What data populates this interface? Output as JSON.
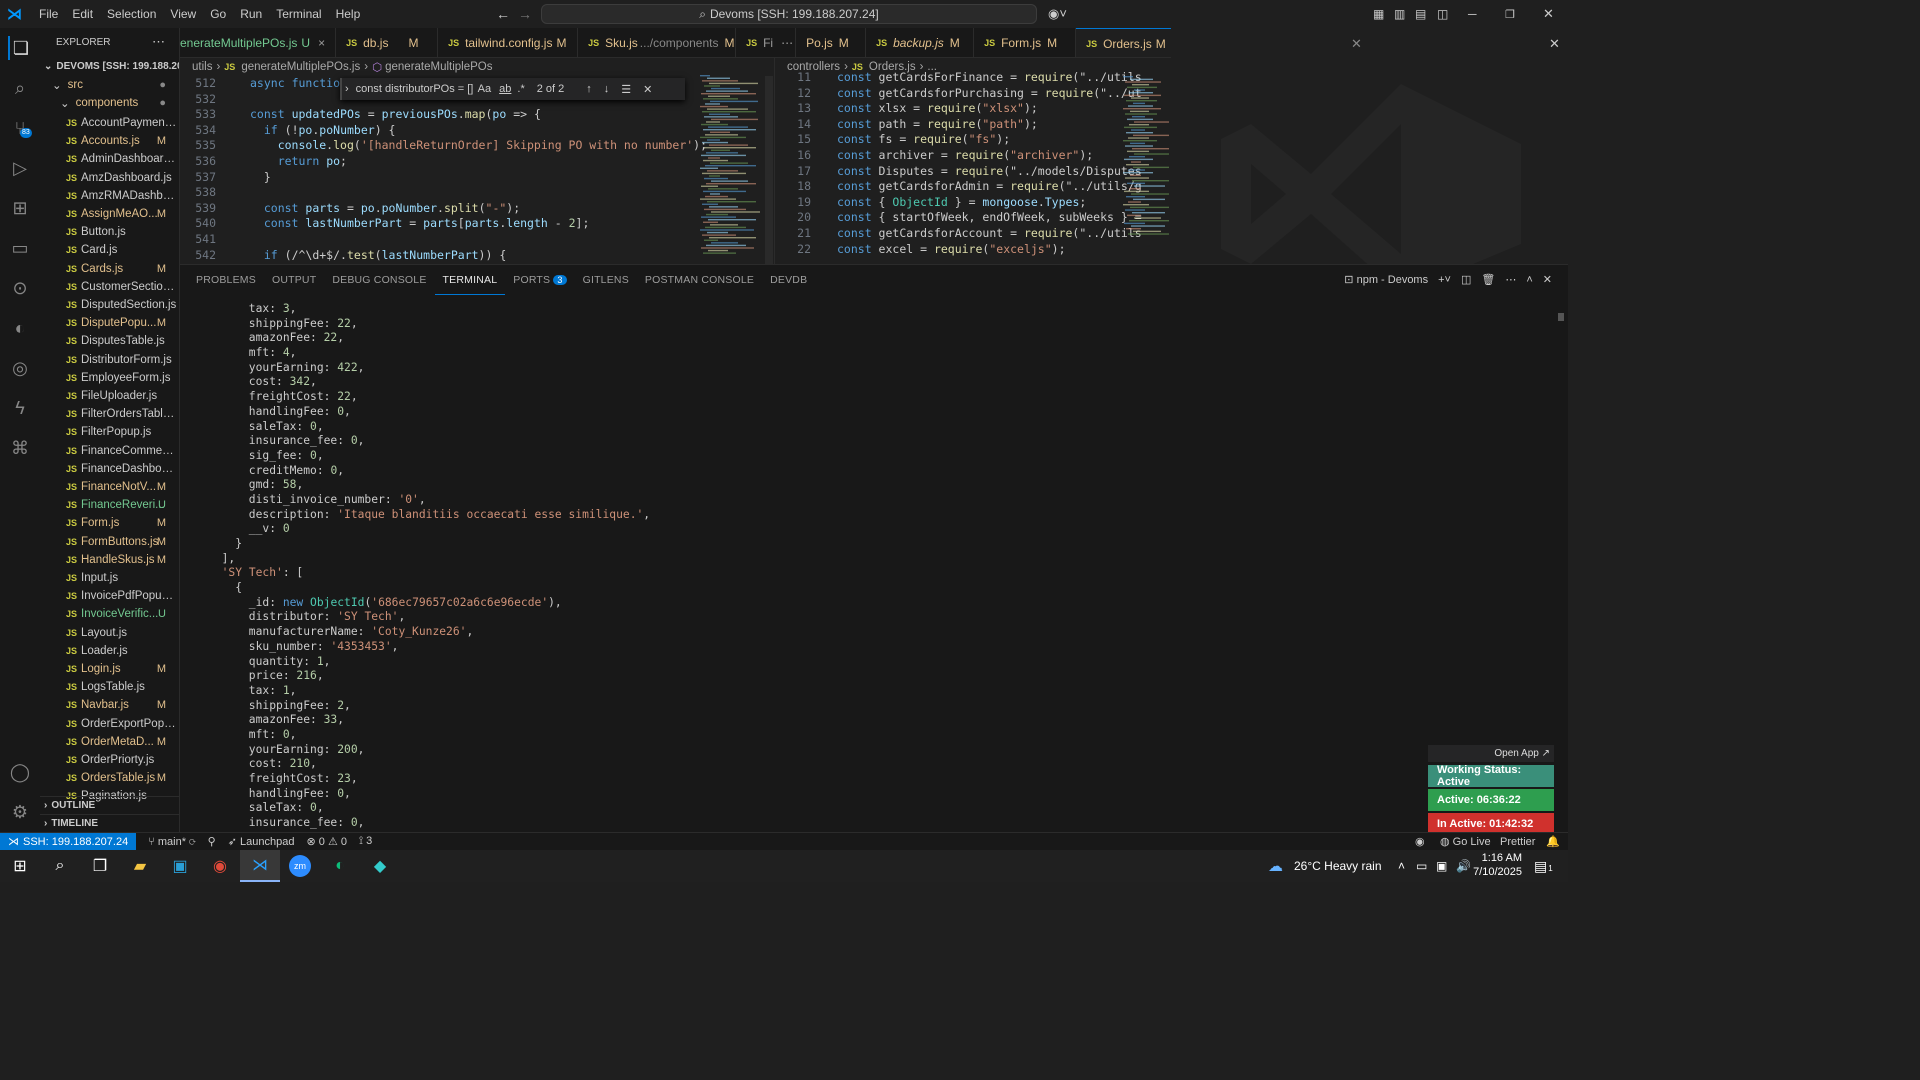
{
  "menu": [
    "File",
    "Edit",
    "Selection",
    "View",
    "Go",
    "Run",
    "Terminal",
    "Help"
  ],
  "command_center": "Devoms [SSH: 199.188.207.24]",
  "explorer": {
    "title": "EXPLORER",
    "root": "DEVOMS [SSH: 199.188.20...",
    "src": "src",
    "components": "components",
    "files": [
      {
        "name": "AccountPaymentP...",
        "status": ""
      },
      {
        "name": "Accounts.js",
        "status": "M"
      },
      {
        "name": "AdminDashboard.js",
        "status": ""
      },
      {
        "name": "AmzDashboard.js",
        "status": ""
      },
      {
        "name": "AmzRMADashboar...",
        "status": ""
      },
      {
        "name": "AssignMeAO...",
        "status": "M"
      },
      {
        "name": "Button.js",
        "status": ""
      },
      {
        "name": "Card.js",
        "status": ""
      },
      {
        "name": "Cards.js",
        "status": "M"
      },
      {
        "name": "CustomerSection.js",
        "status": ""
      },
      {
        "name": "DisputedSection.js",
        "status": ""
      },
      {
        "name": "DisputePopu...",
        "status": "M"
      },
      {
        "name": "DisputesTable.js",
        "status": ""
      },
      {
        "name": "DistributorForm.js",
        "status": ""
      },
      {
        "name": "EmployeeForm.js",
        "status": ""
      },
      {
        "name": "FileUploader.js",
        "status": ""
      },
      {
        "name": "FilterOrdersTable.js",
        "status": ""
      },
      {
        "name": "FilterPopup.js",
        "status": ""
      },
      {
        "name": "FinanceComments.js",
        "status": ""
      },
      {
        "name": "FinanceDashboard.js",
        "status": ""
      },
      {
        "name": "FinanceNotV...",
        "status": "M"
      },
      {
        "name": "FinanceReveri...",
        "status": "U"
      },
      {
        "name": "Form.js",
        "status": "M"
      },
      {
        "name": "FormButtons.js",
        "status": "M"
      },
      {
        "name": "HandleSkus.js",
        "status": "M"
      },
      {
        "name": "Input.js",
        "status": ""
      },
      {
        "name": "InvoicePdfPopup.js",
        "status": ""
      },
      {
        "name": "InvoiceVerific...",
        "status": "U"
      },
      {
        "name": "Layout.js",
        "status": ""
      },
      {
        "name": "Loader.js",
        "status": ""
      },
      {
        "name": "Login.js",
        "status": "M"
      },
      {
        "name": "LogsTable.js",
        "status": ""
      },
      {
        "name": "Navbar.js",
        "status": "M"
      },
      {
        "name": "OrderExportPopup.js",
        "status": ""
      },
      {
        "name": "OrderMetaD...",
        "status": "M"
      },
      {
        "name": "OrderPriorty.js",
        "status": ""
      },
      {
        "name": "OrdersTable.js",
        "status": "M"
      },
      {
        "name": "Pagination.js",
        "status": ""
      }
    ],
    "outline": "OUTLINE",
    "timeline": "TIMELINE"
  },
  "tabs": [
    {
      "label": "enerateMultiplePOs.js",
      "status": "U",
      "close": "×"
    },
    {
      "label": "db.js",
      "status": "M",
      "close": ""
    },
    {
      "label": "tailwind.config.js",
      "status": "M",
      "close": ""
    },
    {
      "label": "Sku.js",
      "sub": ".../components",
      "status": "M",
      "close": ""
    },
    {
      "label": "Fi",
      "status": "",
      "close": ""
    },
    {
      "label": "Po.js",
      "status": "M",
      "close": ""
    },
    {
      "label": "backup.js",
      "status": "M",
      "close": ""
    },
    {
      "label": "Form.js",
      "status": "M",
      "close": ""
    },
    {
      "label": "Orders.js",
      "status": "M",
      "close": "×"
    }
  ],
  "left_editor": {
    "breadcrumb": [
      "utils",
      "generateMultiplePOs.js",
      "generateMultiplePOs"
    ],
    "lines": [
      {
        "n": "512",
        "t": "async function h"
      },
      {
        "n": "532",
        "t": ""
      },
      {
        "n": "533",
        "t": "const updatedPOs = previousPOs.map(po => {"
      },
      {
        "n": "534",
        "t": "  if (!po.poNumber) {"
      },
      {
        "n": "535",
        "t": "    console.log('[handleReturnOrder] Skipping PO with no number');"
      },
      {
        "n": "536",
        "t": "    return po;"
      },
      {
        "n": "537",
        "t": "  }"
      },
      {
        "n": "538",
        "t": ""
      },
      {
        "n": "539",
        "t": "  const parts = po.poNumber.split(\"-\");"
      },
      {
        "n": "540",
        "t": "  const lastNumberPart = parts[parts.length - 2];"
      },
      {
        "n": "541",
        "t": ""
      },
      {
        "n": "542",
        "t": "  if (/^\\d+$/.test(lastNumberPart)) {"
      }
    ]
  },
  "find": {
    "query": "const distributorPOs = [];",
    "opt1": "Aa",
    "opt2": "ab",
    "count": "2 of 2"
  },
  "right_editor": {
    "breadcrumb": [
      "controllers",
      "Orders.js",
      "..."
    ],
    "lines": [
      {
        "n": "11",
        "t": "const getCardsForFinance = require(\"../utils"
      },
      {
        "n": "12",
        "t": "const getCardsforPurchasing = require(\"../ut"
      },
      {
        "n": "13",
        "t": "const xlsx = require(\"xlsx\");"
      },
      {
        "n": "14",
        "t": "const path = require(\"path\");"
      },
      {
        "n": "15",
        "t": "const fs = require(\"fs\");"
      },
      {
        "n": "16",
        "t": "const archiver = require(\"archiver\");"
      },
      {
        "n": "17",
        "t": "const Disputes = require(\"../models/Disputes"
      },
      {
        "n": "18",
        "t": "const getCardsforAdmin = require(\"../utils/g"
      },
      {
        "n": "19",
        "t": "const { ObjectId } = mongoose.Types;"
      },
      {
        "n": "20",
        "t": "const { startOfWeek, endOfWeek, subWeeks } ="
      },
      {
        "n": "21",
        "t": "const getCardsforAccount = require(\"../utils"
      },
      {
        "n": "22",
        "t": "const excel = require(\"exceljs\");"
      }
    ]
  },
  "panel": {
    "tabs": [
      "PROBLEMS",
      "OUTPUT",
      "DEBUG CONSOLE",
      "TERMINAL",
      "PORTS",
      "GITLENS",
      "POSTMAN CONSOLE",
      "DEVDB"
    ],
    "ports_badge": "3",
    "terminal_name": "npm - Devoms"
  },
  "terminal_lines": [
    "      tax: 3,",
    "      shippingFee: 22,",
    "      amazonFee: 22,",
    "      mft: 4,",
    "      yourEarning: 422,",
    "      cost: 342,",
    "      freightCost: 22,",
    "      handlingFee: 0,",
    "      saleTax: 0,",
    "      insurance_fee: 0,",
    "      sig_fee: 0,",
    "      creditMemo: 0,",
    "      gmd: 58,",
    "      disti_invoice_number: '0',",
    "      description: 'Itaque blanditiis occaecati esse similique.',",
    "      __v: 0",
    "    }",
    "  ],",
    "  'SY Tech': [",
    "    {",
    "      _id: new ObjectId('686ec79657c02a6c6e96ecde'),",
    "      distributor: 'SY Tech',",
    "      manufacturerName: 'Coty_Kunze26',",
    "      sku_number: '4353453',",
    "      quantity: 1,",
    "      price: 216,",
    "      tax: 1,",
    "      shippingFee: 2,",
    "      amazonFee: 33,",
    "      mft: 0,",
    "      yourEarning: 200,",
    "      cost: 210,",
    "      freightCost: 23,",
    "      handlingFee: 0,",
    "      saleTax: 0,",
    "      insurance_fee: 0,"
  ],
  "tracker": {
    "open_app": "Open App ↗",
    "working": "Working Status: Active",
    "active": "Active: 06:36:22",
    "inactive": "In Active: 01:42:32",
    "colors": {
      "working": "#3a8f7a",
      "active": "#2e9e4f",
      "inactive": "#d0312d"
    }
  },
  "status": {
    "remote": "SSH: 199.188.207.24",
    "branch": "main*",
    "launchpad": "Launchpad",
    "errors": "0",
    "warnings": "0",
    "ports": "3",
    "golive": "Go Live",
    "prettier": "Prettier"
  },
  "taskbar": {
    "weather": "26°C  Heavy rain",
    "time": "1:16 AM",
    "date": "7/10/2025",
    "notif": "1"
  },
  "activity_badges": {
    "scm": "83"
  }
}
